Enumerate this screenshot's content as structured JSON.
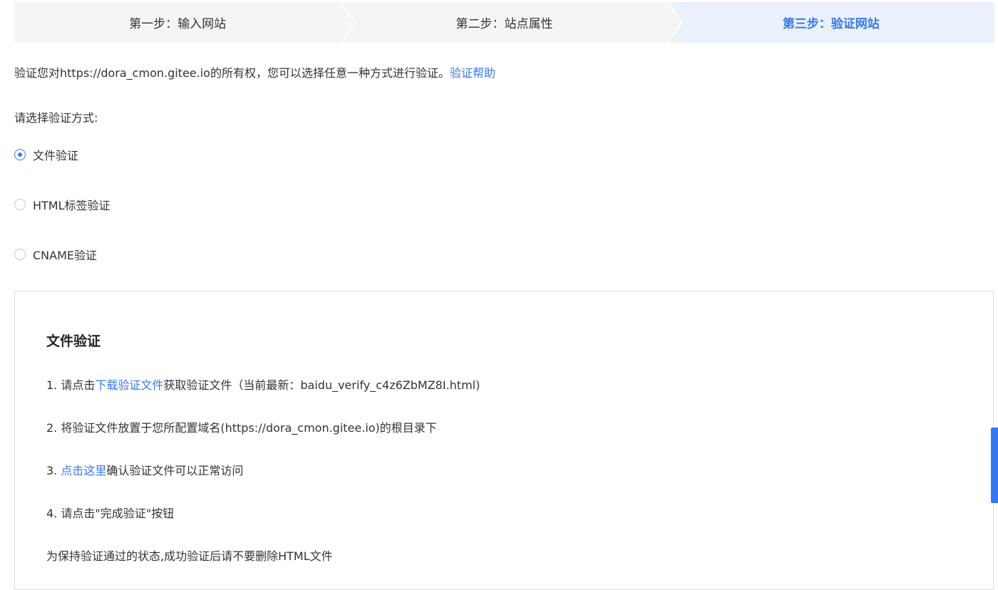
{
  "steps": [
    {
      "label": "第一步：输入网站"
    },
    {
      "label": "第二步：站点属性"
    },
    {
      "label": "第三步：验证网站"
    }
  ],
  "description": {
    "text": "验证您对https://dora_cmon.gitee.io的所有权，您可以选择任意一种方式进行验证。",
    "help_link": "验证帮助"
  },
  "choose_label": "请选择验证方式:",
  "options": [
    {
      "label": "文件验证",
      "checked": true
    },
    {
      "label": "HTML标签验证",
      "checked": false
    },
    {
      "label": "CNAME验证",
      "checked": false
    }
  ],
  "panel": {
    "title": "文件验证",
    "line1": {
      "prefix": "1.  请点击",
      "link": "下载验证文件",
      "suffix": "获取验证文件（当前最新：baidu_verify_c4z6ZbMZ8I.html)"
    },
    "line2": "2.  将验证文件放置于您所配置域名(https://dora_cmon.gitee.io)的根目录下",
    "line3": {
      "prefix": "3.  ",
      "link": "点击这里",
      "suffix": "确认验证文件可以正常访问"
    },
    "line4": "4.  请点击\"完成验证\"按钮",
    "note": "为保持验证通过的状态,成功验证后请不要删除HTML文件"
  },
  "colors": {
    "accent": "#3478f6",
    "active_step_bg": "#eaf1fb",
    "step_bg": "#f5f5f5"
  }
}
